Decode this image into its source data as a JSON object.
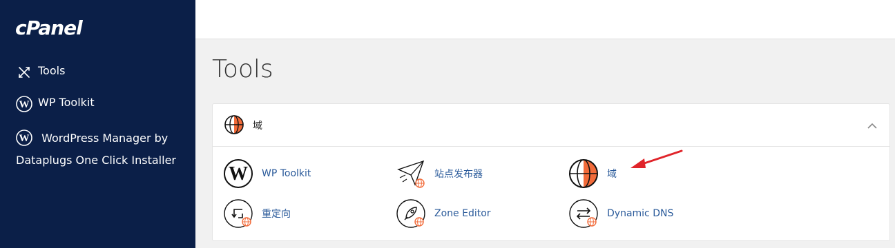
{
  "sidebar": {
    "logo": "cPanel",
    "items": [
      {
        "label": "Tools",
        "icon": "tools-icon"
      },
      {
        "label": "WP Toolkit",
        "icon": "wordpress-icon"
      },
      {
        "label": "WordPress Manager by Dataplugs One Click Installer",
        "icon": "wordpress-icon"
      }
    ]
  },
  "main": {
    "title": "Tools",
    "section": {
      "title": "域",
      "icon": "globe-icon",
      "collapse_icon": "chevron-up-icon",
      "tools": [
        {
          "label": "WP Toolkit",
          "icon": "wordpress-icon"
        },
        {
          "label": "站点发布器",
          "icon": "paper-plane-icon"
        },
        {
          "label": "域",
          "icon": "globe-icon"
        },
        {
          "label": "重定向",
          "icon": "redirect-icon"
        },
        {
          "label": "Zone Editor",
          "icon": "rocket-icon"
        },
        {
          "label": "Dynamic DNS",
          "icon": "exchange-icon"
        }
      ]
    }
  },
  "colors": {
    "sidebar_bg": "#0b1f48",
    "link": "#2a5a9a",
    "accent_orange": "#f26b3a",
    "annotation_arrow": "#e0242a"
  }
}
